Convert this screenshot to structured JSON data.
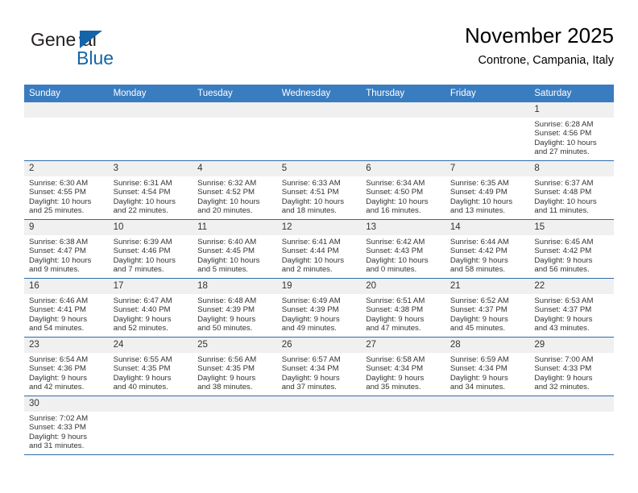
{
  "brand": {
    "name_part1": "General",
    "name_part2": "Blue",
    "logo_icon": "triangle-logo-icon",
    "accent_color": "#1464aa"
  },
  "header": {
    "title": "November 2025",
    "location": "Controne, Campania, Italy"
  },
  "theme": {
    "header_bg": "#3a7cc0",
    "row_divider": "#2f6cab",
    "daynum_bg": "#f0f0f0",
    "text": "#333333"
  },
  "weekdays": [
    "Sunday",
    "Monday",
    "Tuesday",
    "Wednesday",
    "Thursday",
    "Friday",
    "Saturday"
  ],
  "labels": {
    "sunrise": "Sunrise:",
    "sunset": "Sunset:",
    "daylight": "Daylight:"
  },
  "weeks": [
    [
      {
        "day": "",
        "empty": true
      },
      {
        "day": "",
        "empty": true
      },
      {
        "day": "",
        "empty": true
      },
      {
        "day": "",
        "empty": true
      },
      {
        "day": "",
        "empty": true
      },
      {
        "day": "",
        "empty": true
      },
      {
        "day": "1",
        "sunrise": "Sunrise: 6:28 AM",
        "sunset": "Sunset: 4:56 PM",
        "daylight1": "Daylight: 10 hours",
        "daylight2": "and 27 minutes."
      }
    ],
    [
      {
        "day": "2",
        "sunrise": "Sunrise: 6:30 AM",
        "sunset": "Sunset: 4:55 PM",
        "daylight1": "Daylight: 10 hours",
        "daylight2": "and 25 minutes."
      },
      {
        "day": "3",
        "sunrise": "Sunrise: 6:31 AM",
        "sunset": "Sunset: 4:54 PM",
        "daylight1": "Daylight: 10 hours",
        "daylight2": "and 22 minutes."
      },
      {
        "day": "4",
        "sunrise": "Sunrise: 6:32 AM",
        "sunset": "Sunset: 4:52 PM",
        "daylight1": "Daylight: 10 hours",
        "daylight2": "and 20 minutes."
      },
      {
        "day": "5",
        "sunrise": "Sunrise: 6:33 AM",
        "sunset": "Sunset: 4:51 PM",
        "daylight1": "Daylight: 10 hours",
        "daylight2": "and 18 minutes."
      },
      {
        "day": "6",
        "sunrise": "Sunrise: 6:34 AM",
        "sunset": "Sunset: 4:50 PM",
        "daylight1": "Daylight: 10 hours",
        "daylight2": "and 16 minutes."
      },
      {
        "day": "7",
        "sunrise": "Sunrise: 6:35 AM",
        "sunset": "Sunset: 4:49 PM",
        "daylight1": "Daylight: 10 hours",
        "daylight2": "and 13 minutes."
      },
      {
        "day": "8",
        "sunrise": "Sunrise: 6:37 AM",
        "sunset": "Sunset: 4:48 PM",
        "daylight1": "Daylight: 10 hours",
        "daylight2": "and 11 minutes."
      }
    ],
    [
      {
        "day": "9",
        "sunrise": "Sunrise: 6:38 AM",
        "sunset": "Sunset: 4:47 PM",
        "daylight1": "Daylight: 10 hours",
        "daylight2": "and 9 minutes."
      },
      {
        "day": "10",
        "sunrise": "Sunrise: 6:39 AM",
        "sunset": "Sunset: 4:46 PM",
        "daylight1": "Daylight: 10 hours",
        "daylight2": "and 7 minutes."
      },
      {
        "day": "11",
        "sunrise": "Sunrise: 6:40 AM",
        "sunset": "Sunset: 4:45 PM",
        "daylight1": "Daylight: 10 hours",
        "daylight2": "and 5 minutes."
      },
      {
        "day": "12",
        "sunrise": "Sunrise: 6:41 AM",
        "sunset": "Sunset: 4:44 PM",
        "daylight1": "Daylight: 10 hours",
        "daylight2": "and 2 minutes."
      },
      {
        "day": "13",
        "sunrise": "Sunrise: 6:42 AM",
        "sunset": "Sunset: 4:43 PM",
        "daylight1": "Daylight: 10 hours",
        "daylight2": "and 0 minutes."
      },
      {
        "day": "14",
        "sunrise": "Sunrise: 6:44 AM",
        "sunset": "Sunset: 4:42 PM",
        "daylight1": "Daylight: 9 hours",
        "daylight2": "and 58 minutes."
      },
      {
        "day": "15",
        "sunrise": "Sunrise: 6:45 AM",
        "sunset": "Sunset: 4:42 PM",
        "daylight1": "Daylight: 9 hours",
        "daylight2": "and 56 minutes."
      }
    ],
    [
      {
        "day": "16",
        "sunrise": "Sunrise: 6:46 AM",
        "sunset": "Sunset: 4:41 PM",
        "daylight1": "Daylight: 9 hours",
        "daylight2": "and 54 minutes."
      },
      {
        "day": "17",
        "sunrise": "Sunrise: 6:47 AM",
        "sunset": "Sunset: 4:40 PM",
        "daylight1": "Daylight: 9 hours",
        "daylight2": "and 52 minutes."
      },
      {
        "day": "18",
        "sunrise": "Sunrise: 6:48 AM",
        "sunset": "Sunset: 4:39 PM",
        "daylight1": "Daylight: 9 hours",
        "daylight2": "and 50 minutes."
      },
      {
        "day": "19",
        "sunrise": "Sunrise: 6:49 AM",
        "sunset": "Sunset: 4:39 PM",
        "daylight1": "Daylight: 9 hours",
        "daylight2": "and 49 minutes."
      },
      {
        "day": "20",
        "sunrise": "Sunrise: 6:51 AM",
        "sunset": "Sunset: 4:38 PM",
        "daylight1": "Daylight: 9 hours",
        "daylight2": "and 47 minutes."
      },
      {
        "day": "21",
        "sunrise": "Sunrise: 6:52 AM",
        "sunset": "Sunset: 4:37 PM",
        "daylight1": "Daylight: 9 hours",
        "daylight2": "and 45 minutes."
      },
      {
        "day": "22",
        "sunrise": "Sunrise: 6:53 AM",
        "sunset": "Sunset: 4:37 PM",
        "daylight1": "Daylight: 9 hours",
        "daylight2": "and 43 minutes."
      }
    ],
    [
      {
        "day": "23",
        "sunrise": "Sunrise: 6:54 AM",
        "sunset": "Sunset: 4:36 PM",
        "daylight1": "Daylight: 9 hours",
        "daylight2": "and 42 minutes."
      },
      {
        "day": "24",
        "sunrise": "Sunrise: 6:55 AM",
        "sunset": "Sunset: 4:35 PM",
        "daylight1": "Daylight: 9 hours",
        "daylight2": "and 40 minutes."
      },
      {
        "day": "25",
        "sunrise": "Sunrise: 6:56 AM",
        "sunset": "Sunset: 4:35 PM",
        "daylight1": "Daylight: 9 hours",
        "daylight2": "and 38 minutes."
      },
      {
        "day": "26",
        "sunrise": "Sunrise: 6:57 AM",
        "sunset": "Sunset: 4:34 PM",
        "daylight1": "Daylight: 9 hours",
        "daylight2": "and 37 minutes."
      },
      {
        "day": "27",
        "sunrise": "Sunrise: 6:58 AM",
        "sunset": "Sunset: 4:34 PM",
        "daylight1": "Daylight: 9 hours",
        "daylight2": "and 35 minutes."
      },
      {
        "day": "28",
        "sunrise": "Sunrise: 6:59 AM",
        "sunset": "Sunset: 4:34 PM",
        "daylight1": "Daylight: 9 hours",
        "daylight2": "and 34 minutes."
      },
      {
        "day": "29",
        "sunrise": "Sunrise: 7:00 AM",
        "sunset": "Sunset: 4:33 PM",
        "daylight1": "Daylight: 9 hours",
        "daylight2": "and 32 minutes."
      }
    ],
    [
      {
        "day": "30",
        "sunrise": "Sunrise: 7:02 AM",
        "sunset": "Sunset: 4:33 PM",
        "daylight1": "Daylight: 9 hours",
        "daylight2": "and 31 minutes."
      },
      {
        "day": "",
        "empty": true
      },
      {
        "day": "",
        "empty": true
      },
      {
        "day": "",
        "empty": true
      },
      {
        "day": "",
        "empty": true
      },
      {
        "day": "",
        "empty": true
      },
      {
        "day": "",
        "empty": true
      }
    ]
  ]
}
